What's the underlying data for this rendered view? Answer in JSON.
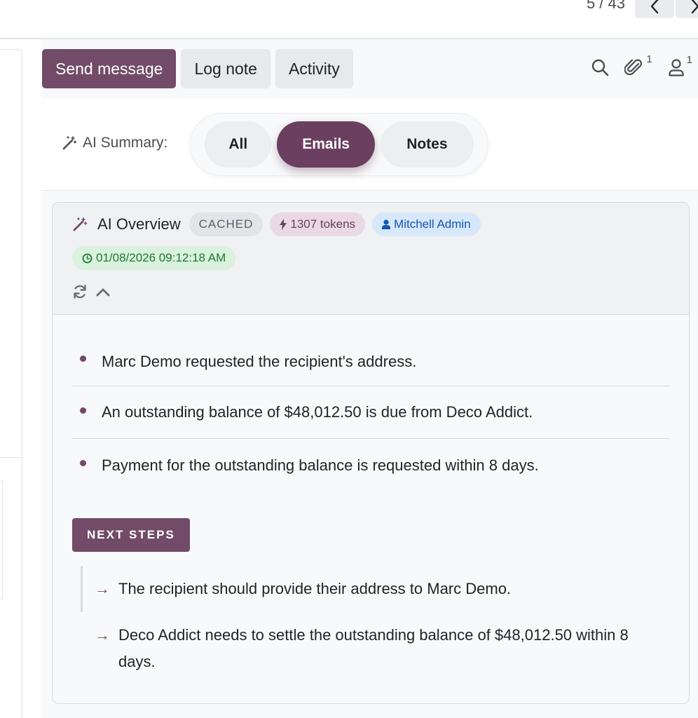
{
  "pager": {
    "text": "5 / 43"
  },
  "chatter": {
    "actions": {
      "send_message": "Send message",
      "log_note": "Log note",
      "activity": "Activity"
    },
    "tools": {
      "attachments_count": "1",
      "followers_count": "1"
    }
  },
  "ai_summary": {
    "label": "AI Summary:",
    "filters": {
      "all": "All",
      "emails": "Emails",
      "notes": "Notes"
    },
    "selected": "Emails"
  },
  "overview": {
    "title": "AI Overview",
    "cached_badge": "CACHED",
    "tokens_badge": "1307 tokens",
    "user_badge": "Mitchell Admin",
    "timestamp": "01/08/2026 09:12:18 AM",
    "points": [
      "Marc Demo requested the recipient's address.",
      "An outstanding balance of $48,012.50 is due from Deco Addict.",
      "Payment for the outstanding balance is requested within 8 days."
    ],
    "next_steps_label": "NEXT STEPS",
    "next_steps": [
      "The recipient should provide their address to Marc Demo.",
      "Deco Addict needs to settle the outstanding balance of $48,012.50 within 8 days."
    ]
  },
  "colors": {
    "primary": "#714b67",
    "emails_active": "#6b3f5f",
    "time_badge_text": "#1d7a34",
    "user_badge_text": "#0f57b3"
  }
}
